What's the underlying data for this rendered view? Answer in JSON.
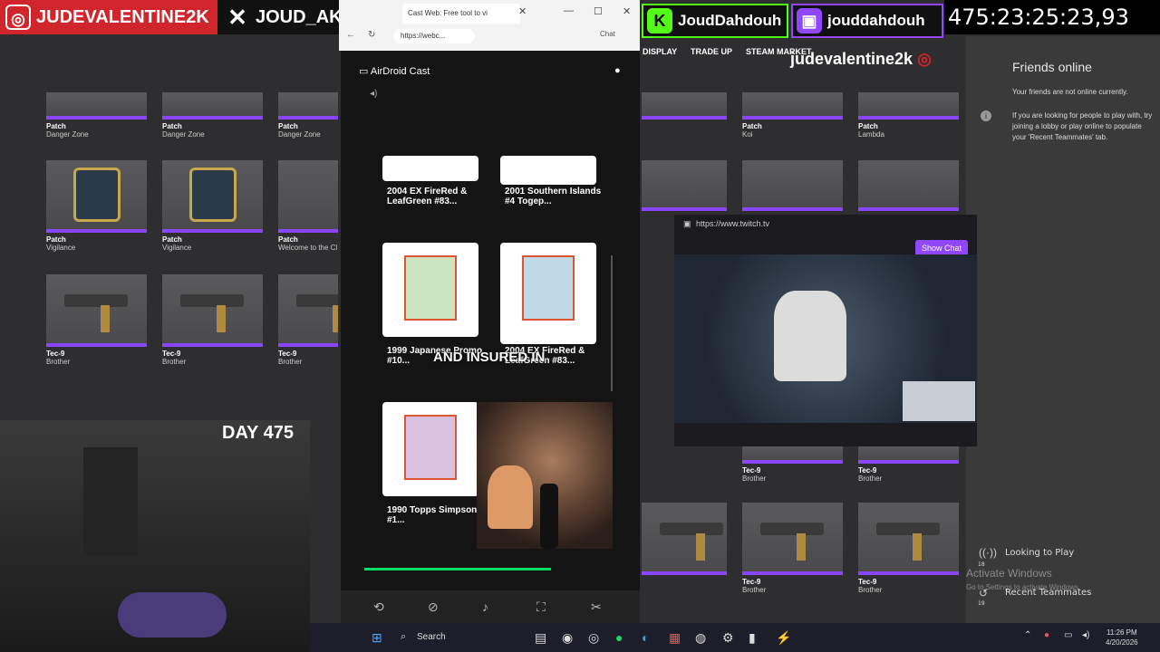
{
  "overlay": {
    "instagram": "JUDEVALENTINE2K",
    "x_handle": "JOUD_AKA_J",
    "kick": "JoudDahdouh",
    "twitch": "jouddahdouh",
    "timer": "475:23:25:23,93",
    "day": "DAY 475",
    "streamer_tag": "judevalentine2k"
  },
  "browser": {
    "tab_title": "Cast Web: Free tool to vi",
    "address": "https://webc...",
    "chat_label": "Chat"
  },
  "cast": {
    "app_title": "AirDroid Cast",
    "cards": [
      {
        "caption": "2004 EX FireRed & LeafGreen #83..."
      },
      {
        "caption": "2001 Southern Islands #4 Togep..."
      },
      {
        "caption": "1999 Japanese Promo #10..."
      },
      {
        "caption": "2004 EX FireRed & LeafGreen #83..."
      },
      {
        "caption": "1990 Topps Simpsons #1..."
      }
    ],
    "subtitle": "AND INSURED IN"
  },
  "cs": {
    "nav": [
      "DISPLAY",
      "TRADE UP",
      "STEAM MARKET"
    ],
    "items": [
      {
        "cat": "Patch",
        "name": "Danger Zone"
      },
      {
        "cat": "Patch",
        "name": "Danger Zone"
      },
      {
        "cat": "Patch",
        "name": "Danger Zone"
      },
      {
        "cat": "Patch",
        "name": "Vigilance"
      },
      {
        "cat": "Patch",
        "name": "Vigilance"
      },
      {
        "cat": "Patch",
        "name": "Welcome to the Cl"
      },
      {
        "cat": "Tec-9",
        "name": "Brother"
      },
      {
        "cat": "Tec-9",
        "name": "Brother"
      },
      {
        "cat": "Tec-9",
        "name": "Brother"
      },
      {
        "cat": "Patch",
        "name": "Koi"
      },
      {
        "cat": "Patch",
        "name": "Lambda"
      },
      {
        "cat": "Tec-9",
        "name": "Brother"
      },
      {
        "cat": "Tec-9",
        "name": "Brother"
      },
      {
        "cat": "Tec-9",
        "name": "Brother"
      },
      {
        "cat": "Tec-9",
        "name": "Brother"
      }
    ]
  },
  "twitch_popup": {
    "url": "https://www.twitch.tv",
    "show_chat": "Show Chat"
  },
  "friends": {
    "title": "Friends online",
    "not_online": "Your friends are not online currently.",
    "hint": "If you are looking for people to play with, try joining a lobby or play online to populate your 'Recent Teammates' tab.",
    "looking": "Looking to Play",
    "looking_count": "18",
    "recent": "Recent Teammates",
    "recent_count": "19",
    "activate": "Activate Windows",
    "activate_sub": "Go to Settings to activate Windows."
  },
  "taskbar": {
    "search": "Search",
    "time": "11:26 PM",
    "date": "4/20/2026"
  },
  "colors": {
    "instagram": "#d0262b",
    "kick": "#53fc18",
    "twitch": "#9146ff",
    "rarity": "#8847ff"
  }
}
